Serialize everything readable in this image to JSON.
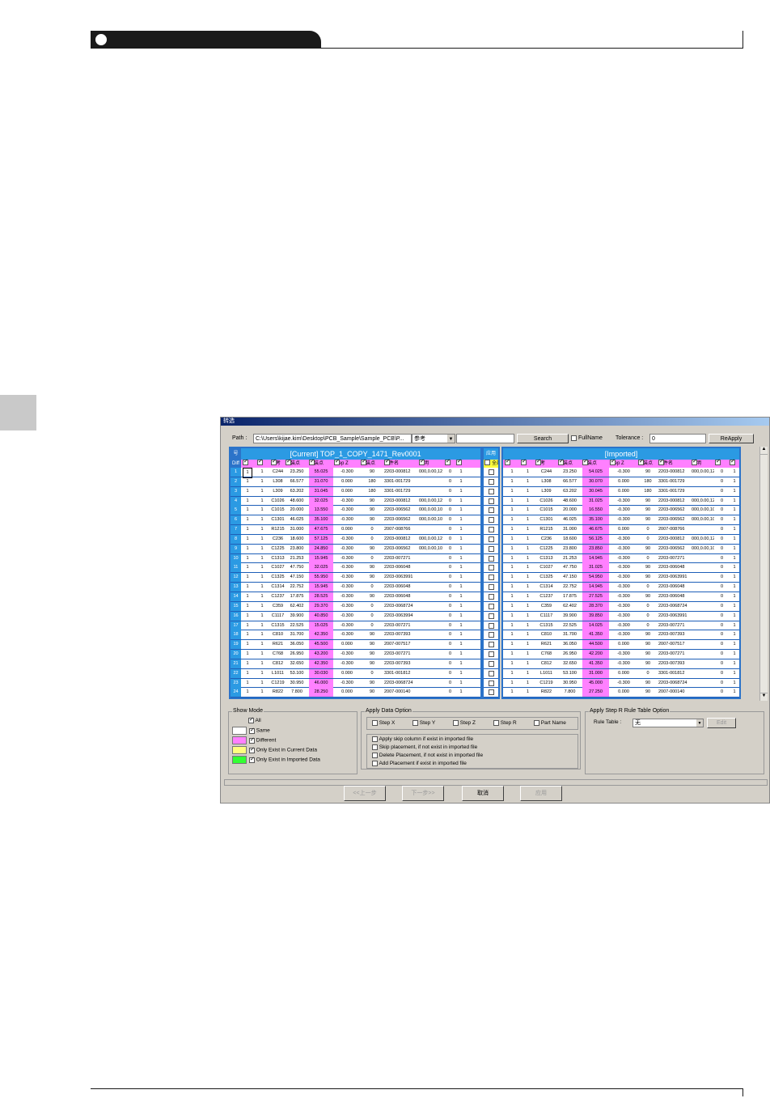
{
  "window": {
    "title": "转选"
  },
  "path": {
    "label": "Path :",
    "value": "C:\\Users\\kijae.kim\\Desktop\\PCB_Sample\\Sample_PCB\\P...",
    "combo_value": "参考",
    "search": "Search",
    "fullname": "FullName",
    "tolerance_label": "Tolerance :",
    "tolerance_value": "0",
    "reapply": "ReApply"
  },
  "current": {
    "no_header": "号",
    "title": "[Current] TOP_1_COPY_1471_Rev0001",
    "diff_label": "Diff",
    "columns": [
      "槽",
      "块",
      "参考",
      "贴装点",
      "贴装点",
      "Step Z",
      "贴装点",
      "元件名",
      "说明",
      "驱",
      "转"
    ]
  },
  "apply": {
    "header": "应用",
    "all": "全部"
  },
  "imported": {
    "title": "[Imported]",
    "columns": [
      "槽",
      "块",
      "参考",
      "贴装点",
      "贴装点",
      "Step Z",
      "贴装点",
      "元件名",
      "说明",
      "驱",
      "转"
    ]
  },
  "rows": [
    {
      "n": "1",
      "c": [
        "1",
        "1",
        "C244",
        "23.250",
        "55.025",
        "-0.300",
        "90",
        "2203-000812",
        "000,0.00,12",
        "0",
        "1"
      ],
      "i": [
        "1",
        "1",
        "C244",
        "23.250",
        "54.025",
        "-0.300",
        "90",
        "2203-000812",
        "000,0.00,12",
        "0",
        "1"
      ]
    },
    {
      "n": "2",
      "c": [
        "1",
        "1",
        "L308",
        "66.577",
        "31.070",
        "0.000",
        "180",
        "3301-001729",
        "",
        "0",
        "1"
      ],
      "i": [
        "1",
        "1",
        "L308",
        "66.577",
        "30.070",
        "0.000",
        "180",
        "3301-001729",
        "",
        "0",
        "1"
      ]
    },
    {
      "n": "3",
      "c": [
        "1",
        "1",
        "L309",
        "63.202",
        "31.045",
        "0.000",
        "180",
        "3301-001729",
        "",
        "0",
        "1"
      ],
      "i": [
        "1",
        "1",
        "L309",
        "63.202",
        "30.045",
        "0.000",
        "180",
        "3301-001729",
        "",
        "0",
        "1"
      ]
    },
    {
      "n": "4",
      "c": [
        "1",
        "1",
        "C1026",
        "48.600",
        "32.025",
        "-0.300",
        "90",
        "2203-000812",
        "000,0.00,12",
        "0",
        "1"
      ],
      "i": [
        "1",
        "1",
        "C1026",
        "48.600",
        "31.025",
        "-0.300",
        "90",
        "2203-000812",
        "000,0.00,12",
        "0",
        "1"
      ]
    },
    {
      "n": "5",
      "c": [
        "1",
        "1",
        "C1015",
        "20.000",
        "13.550",
        "-0.300",
        "90",
        "2203-006562",
        "000,0.00,10",
        "0",
        "1"
      ],
      "i": [
        "1",
        "1",
        "C1015",
        "20.000",
        "16.550",
        "-0.300",
        "90",
        "2203-006562",
        "000,0.00,10",
        "0",
        "1"
      ]
    },
    {
      "n": "6",
      "c": [
        "1",
        "1",
        "C1301",
        "46.025",
        "35.100",
        "-0.300",
        "90",
        "2203-006562",
        "000,0.00,10",
        "0",
        "1"
      ],
      "i": [
        "1",
        "1",
        "C1301",
        "46.025",
        "35.100",
        "-0.300",
        "90",
        "2203-006562",
        "000,0.00,10",
        "0",
        "1"
      ]
    },
    {
      "n": "7",
      "c": [
        "1",
        "1",
        "R1215",
        "31.000",
        "47.675",
        "0.000",
        "0",
        "2007-008766",
        "",
        "0",
        "1"
      ],
      "i": [
        "1",
        "1",
        "R1215",
        "31.000",
        "46.675",
        "0.000",
        "0",
        "2007-008766",
        "",
        "0",
        "1"
      ]
    },
    {
      "n": "8",
      "c": [
        "1",
        "1",
        "C236",
        "18.600",
        "57.125",
        "-0.300",
        "0",
        "2203-000812",
        "000,0.00,12",
        "0",
        "1"
      ],
      "i": [
        "1",
        "1",
        "C236",
        "18.600",
        "56.125",
        "-0.300",
        "0",
        "2203-000812",
        "000,0.00,12",
        "0",
        "1"
      ]
    },
    {
      "n": "9",
      "c": [
        "1",
        "1",
        "C1225",
        "23.800",
        "24.850",
        "-0.300",
        "90",
        "2203-006562",
        "000,0.00,10",
        "0",
        "1"
      ],
      "i": [
        "1",
        "1",
        "C1225",
        "23.800",
        "23.850",
        "-0.300",
        "90",
        "2203-006562",
        "000,0.00,10",
        "0",
        "1"
      ]
    },
    {
      "n": "10",
      "c": [
        "1",
        "1",
        "C1313",
        "21.253",
        "15.945",
        "-0.300",
        "0",
        "2203-007271",
        "",
        "0",
        "1"
      ],
      "i": [
        "1",
        "1",
        "C1313",
        "21.253",
        "14.945",
        "-0.300",
        "0",
        "2203-007271",
        "",
        "0",
        "1"
      ]
    },
    {
      "n": "11",
      "c": [
        "1",
        "1",
        "C1027",
        "47.750",
        "32.025",
        "-0.300",
        "90",
        "2203-006048",
        "",
        "0",
        "1"
      ],
      "i": [
        "1",
        "1",
        "C1027",
        "47.750",
        "31.025",
        "-0.300",
        "90",
        "2203-006048",
        "",
        "0",
        "1"
      ]
    },
    {
      "n": "12",
      "c": [
        "1",
        "1",
        "C1325",
        "47.150",
        "55.950",
        "-0.300",
        "90",
        "2203-0063991",
        "",
        "0",
        "1"
      ],
      "i": [
        "1",
        "1",
        "C1325",
        "47.150",
        "54.950",
        "-0.300",
        "90",
        "2203-0063991",
        "",
        "0",
        "1"
      ]
    },
    {
      "n": "13",
      "c": [
        "1",
        "1",
        "C1314",
        "22.752",
        "15.945",
        "-0.300",
        "0",
        "2203-006048",
        "",
        "0",
        "1"
      ],
      "i": [
        "1",
        "1",
        "C1314",
        "22.752",
        "14.945",
        "-0.300",
        "0",
        "2203-006048",
        "",
        "0",
        "1"
      ]
    },
    {
      "n": "14",
      "c": [
        "1",
        "1",
        "C1237",
        "17.875",
        "28.525",
        "-0.300",
        "90",
        "2203-006048",
        "",
        "0",
        "1"
      ],
      "i": [
        "1",
        "1",
        "C1237",
        "17.875",
        "27.525",
        "-0.300",
        "90",
        "2203-006048",
        "",
        "0",
        "1"
      ]
    },
    {
      "n": "15",
      "c": [
        "1",
        "1",
        "C359",
        "62.402",
        "29.370",
        "-0.300",
        "0",
        "2203-0068724",
        "",
        "0",
        "1"
      ],
      "i": [
        "1",
        "1",
        "C359",
        "62.402",
        "28.370",
        "-0.300",
        "0",
        "2203-0068724",
        "",
        "0",
        "1"
      ]
    },
    {
      "n": "16",
      "c": [
        "1",
        "1",
        "C1117",
        "39.900",
        "40.850",
        "-0.300",
        "0",
        "2203-0063994",
        "",
        "0",
        "1"
      ],
      "i": [
        "1",
        "1",
        "C1117",
        "39.900",
        "39.850",
        "-0.300",
        "0",
        "2203-0063991",
        "",
        "0",
        "1"
      ]
    },
    {
      "n": "17",
      "c": [
        "1",
        "1",
        "C1315",
        "22.525",
        "15.025",
        "-0.300",
        "0",
        "2203-007271",
        "",
        "0",
        "1"
      ],
      "i": [
        "1",
        "1",
        "C1315",
        "22.525",
        "14.025",
        "-0.300",
        "0",
        "2203-007271",
        "",
        "0",
        "1"
      ]
    },
    {
      "n": "18",
      "c": [
        "1",
        "1",
        "C810",
        "31.700",
        "42.350",
        "-0.300",
        "90",
        "2203-007393",
        "",
        "0",
        "1"
      ],
      "i": [
        "1",
        "1",
        "C810",
        "31.700",
        "41.350",
        "-0.300",
        "90",
        "2203-007393",
        "",
        "0",
        "1"
      ]
    },
    {
      "n": "19",
      "c": [
        "1",
        "1",
        "R621",
        "36.050",
        "45.500",
        "0.000",
        "90",
        "2007-007517",
        "",
        "0",
        "1"
      ],
      "i": [
        "1",
        "1",
        "R621",
        "36.050",
        "44.500",
        "0.000",
        "90",
        "2007-007517",
        "",
        "0",
        "1"
      ]
    },
    {
      "n": "20",
      "c": [
        "1",
        "1",
        "C768",
        "26.950",
        "43.200",
        "-0.300",
        "90",
        "2203-007271",
        "",
        "0",
        "1"
      ],
      "i": [
        "1",
        "1",
        "C768",
        "26.950",
        "42.200",
        "-0.300",
        "90",
        "2203-007271",
        "",
        "0",
        "1"
      ]
    },
    {
      "n": "21",
      "c": [
        "1",
        "1",
        "C812",
        "32.650",
        "42.350",
        "-0.300",
        "90",
        "2203-007393",
        "",
        "0",
        "1"
      ],
      "i": [
        "1",
        "1",
        "C812",
        "32.650",
        "41.350",
        "-0.300",
        "90",
        "2203-007393",
        "",
        "0",
        "1"
      ]
    },
    {
      "n": "22",
      "c": [
        "1",
        "1",
        "L1011",
        "53.100",
        "30.030",
        "0.000",
        "0",
        "3301-001812",
        "",
        "0",
        "1"
      ],
      "i": [
        "1",
        "1",
        "L1011",
        "53.100",
        "31.000",
        "0.000",
        "0",
        "3301-001812",
        "",
        "0",
        "1"
      ]
    },
    {
      "n": "23",
      "c": [
        "1",
        "1",
        "C1219",
        "30.950",
        "46.000",
        "-0.300",
        "90",
        "2203-0068724",
        "",
        "0",
        "1"
      ],
      "i": [
        "1",
        "1",
        "C1219",
        "30.950",
        "45.000",
        "-0.300",
        "90",
        "2203-0068724",
        "",
        "0",
        "1"
      ]
    },
    {
      "n": "24",
      "c": [
        "1",
        "1",
        "R822",
        "7.800",
        "28.250",
        "0.000",
        "90",
        "2007-000140",
        "",
        "0",
        "1"
      ],
      "i": [
        "1",
        "1",
        "R822",
        "7.800",
        "27.250",
        "0.000",
        "90",
        "2007-000140",
        "",
        "0",
        "1"
      ]
    }
  ],
  "show_mode": {
    "title": "Show Mode",
    "all": "All",
    "items": [
      {
        "label": "Same",
        "color": "#ffffff"
      },
      {
        "label": "Different",
        "color": "#ff80ff"
      },
      {
        "label": "Only Exist in Current Data",
        "color": "#ffff80"
      },
      {
        "label": "Only Exist in Imported Data",
        "color": "#33ff33"
      }
    ]
  },
  "apply_data": {
    "title": "Apply Data Option",
    "steps": [
      "Step X",
      "Step Y",
      "Step Z",
      "Step R",
      "Part Name"
    ],
    "options": [
      "Apply skip column if exist in imported file",
      "Skip placement, if not exist in imported file",
      "Delete Placement, if not exist in imported file",
      "Add Placement if exist in imported file"
    ]
  },
  "rule": {
    "title": "Apply Step R Rule Table Option",
    "label": "Rule Table :",
    "value": "无",
    "edit": "Edit"
  },
  "nav": {
    "prev": "<<上一步",
    "next": "下一步>>",
    "cancel": "取消",
    "apply": "应用"
  }
}
